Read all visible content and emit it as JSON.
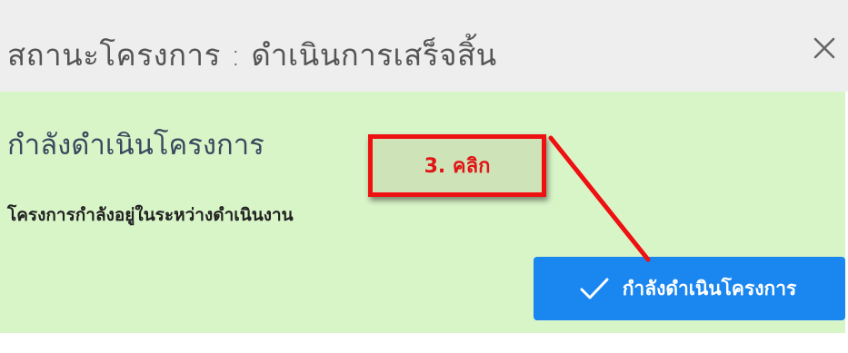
{
  "modal": {
    "title": "สถานะโครงการ : ดำเนินการเสร็จสิ้น",
    "close_icon": "close-icon"
  },
  "status_panel": {
    "heading": "กำลังดำเนินโครงการ",
    "description": "โครงการกำลังอยู่ในระหว่างดำเนินงาน",
    "background": "#d8f5c8"
  },
  "action_button": {
    "icon": "check-icon",
    "label": "กำลังดำเนินโครงการ",
    "color": "#1a86f0"
  },
  "annotation": {
    "label": "3. คลิก",
    "color": "#ee1111"
  }
}
